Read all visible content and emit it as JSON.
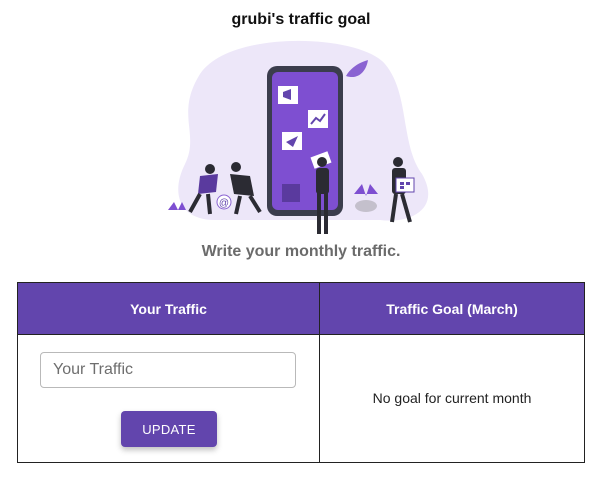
{
  "page": {
    "title": "grubi's traffic goal",
    "subtitle": "Write your monthly traffic."
  },
  "table": {
    "headers": [
      "Your Traffic",
      "Traffic Goal (March)"
    ],
    "input_placeholder": "Your Traffic",
    "input_value": "",
    "update_label": "UPDATE",
    "goal_status": "No goal for current month"
  },
  "colors": {
    "accent": "#6245ad",
    "illustration_background": "#ede7f9"
  },
  "illustration": {
    "icons": [
      "megaphone-icon",
      "chart-icon",
      "paper-plane-icon",
      "at-sign-icon",
      "calendar-icon"
    ]
  }
}
